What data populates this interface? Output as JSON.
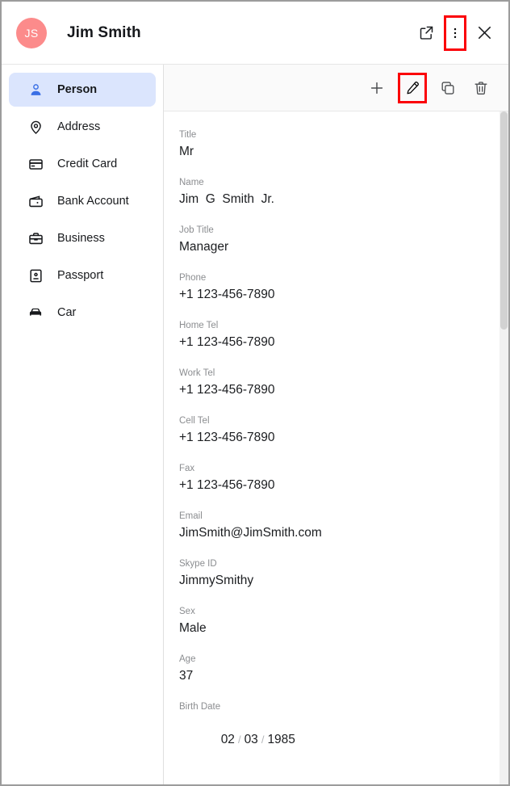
{
  "header": {
    "avatar_initials": "JS",
    "title": "Jim Smith",
    "actions": [
      {
        "name": "open-external-icon",
        "label": "Open in new window",
        "highlighted": false
      },
      {
        "name": "more-options-icon",
        "label": "More options",
        "highlighted": true
      },
      {
        "name": "close-icon",
        "label": "Close",
        "highlighted": false
      }
    ]
  },
  "sidebar": {
    "items": [
      {
        "label": "Person",
        "icon": "person-icon",
        "selected": true
      },
      {
        "label": "Address",
        "icon": "location-pin-icon",
        "selected": false
      },
      {
        "label": "Credit Card",
        "icon": "credit-card-icon",
        "selected": false
      },
      {
        "label": "Bank Account",
        "icon": "wallet-icon",
        "selected": false
      },
      {
        "label": "Business",
        "icon": "briefcase-icon",
        "selected": false
      },
      {
        "label": "Passport",
        "icon": "id-card-icon",
        "selected": false
      },
      {
        "label": "Car",
        "icon": "car-icon",
        "selected": false
      }
    ]
  },
  "toolbar": {
    "actions": [
      {
        "label": "Add",
        "icon": "plus-icon",
        "highlighted": false
      },
      {
        "label": "Edit",
        "icon": "pencil-icon",
        "highlighted": true
      },
      {
        "label": "Duplicate",
        "icon": "copy-icon",
        "highlighted": false
      },
      {
        "label": "Delete",
        "icon": "trash-icon",
        "highlighted": false
      }
    ]
  },
  "fields": [
    {
      "label": "Title",
      "value": "Mr"
    },
    {
      "label": "Name",
      "value": "Jim  G  Smith  Jr."
    },
    {
      "label": "Job Title",
      "value": "Manager"
    },
    {
      "label": "Phone",
      "value": "+1 123-456-7890"
    },
    {
      "label": "Home Tel",
      "value": "+1 123-456-7890"
    },
    {
      "label": "Work Tel",
      "value": "+1 123-456-7890"
    },
    {
      "label": "Cell Tel",
      "value": "+1 123-456-7890"
    },
    {
      "label": "Fax",
      "value": "+1 123-456-7890"
    },
    {
      "label": "Email",
      "value": "JimSmith@JimSmith.com"
    },
    {
      "label": "Skype ID",
      "value": "JimmySmithy"
    },
    {
      "label": "Sex",
      "value": "Male"
    },
    {
      "label": "Age",
      "value": "37"
    },
    {
      "label": "Birth Date",
      "value": "02 / 03 / 1985",
      "parts": [
        "02",
        "03",
        "1985"
      ],
      "separator": "/"
    }
  ],
  "colors": {
    "avatar_bg": "#fc8b8b",
    "selected_nav_bg": "#dbe5fd",
    "selected_nav_icon": "#3a6fe5",
    "highlight_box": "#fb0007",
    "label_text": "#8b8d90",
    "value_text": "#1b1d20"
  }
}
